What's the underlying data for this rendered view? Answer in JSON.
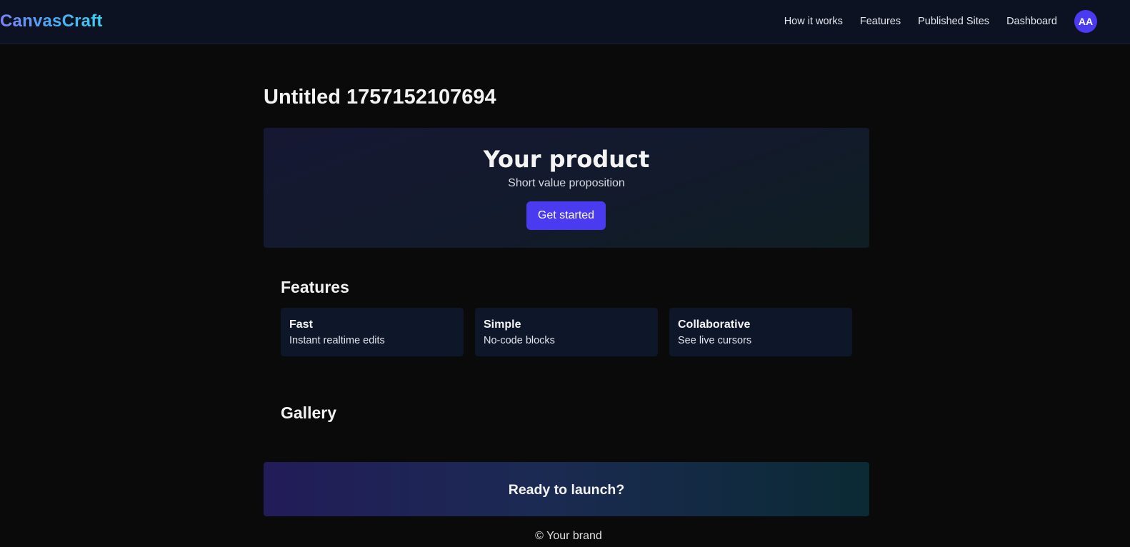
{
  "header": {
    "logo": "CanvasCraft",
    "nav": [
      {
        "label": "How it works"
      },
      {
        "label": "Features"
      },
      {
        "label": "Published Sites"
      },
      {
        "label": "Dashboard"
      }
    ],
    "avatar_initials": "AA"
  },
  "page": {
    "title": "Untitled 1757152107694"
  },
  "hero": {
    "title": "Your product",
    "subtitle": "Short value proposition",
    "cta_label": "Get started"
  },
  "features": {
    "title": "Features",
    "items": [
      {
        "name": "Fast",
        "desc": "Instant realtime edits"
      },
      {
        "name": "Simple",
        "desc": "No-code blocks"
      },
      {
        "name": "Collaborative",
        "desc": "See live cursors"
      }
    ]
  },
  "gallery": {
    "title": "Gallery"
  },
  "cta": {
    "text": "Ready to launch?"
  },
  "footer": {
    "text": "© Your brand"
  },
  "colors": {
    "accent": "#4b3bf0",
    "background": "#0a0a0a",
    "header_bg": "#0c1222",
    "card_bg": "#0e162a"
  }
}
